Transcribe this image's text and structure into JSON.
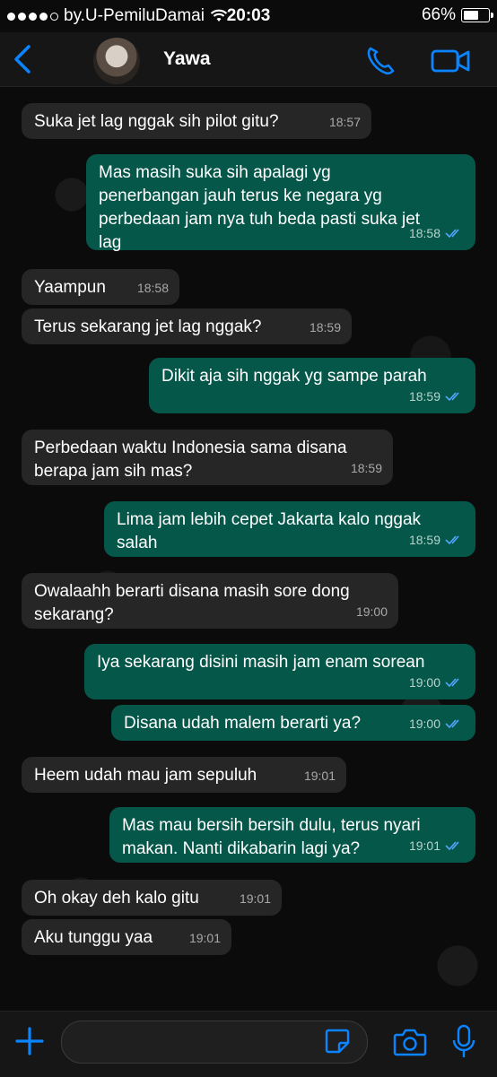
{
  "status": {
    "carrier": "by.U-PemiluDamai",
    "time": "20:03",
    "battery": "66%",
    "battery_level": 0.66,
    "signal_dots": 4
  },
  "header": {
    "contact_name": "Yawa",
    "back_icon": "chevron-left-icon",
    "call_icon": "phone-icon",
    "video_icon": "video-camera-icon"
  },
  "colors": {
    "accent": "#0a84ff",
    "incoming_bubble": "#262626",
    "outgoing_bubble": "#05574a",
    "tick": "#53a6ff"
  },
  "messages": [
    {
      "dir": "in",
      "text": "Suka jet lag nggak sih pilot gitu?",
      "time": "18:57"
    },
    {
      "dir": "out",
      "text": "Mas masih suka sih apalagi yg\npenerbangan jauh terus ke negara yg\nperbedaan jam nya tuh beda pasti suka jet\nlag",
      "time": "18:58"
    },
    {
      "dir": "in",
      "text": "Yaampun",
      "time": "18:58"
    },
    {
      "dir": "in",
      "text": "Terus sekarang jet lag nggak?",
      "time": "18:59"
    },
    {
      "dir": "out",
      "text": "Dikit aja sih nggak yg sampe parah",
      "time": "18:59"
    },
    {
      "dir": "in",
      "text": "Perbedaan waktu Indonesia sama disana\nberapa jam sih mas?",
      "time": "18:59"
    },
    {
      "dir": "out",
      "text": "Lima jam lebih cepet Jakarta kalo nggak\nsalah",
      "time": "18:59"
    },
    {
      "dir": "in",
      "text": "Owalaahh berarti disana masih sore dong\nsekarang?",
      "time": "19:00"
    },
    {
      "dir": "out",
      "text": "Iya sekarang disini masih jam enam sorean",
      "time": "19:00"
    },
    {
      "dir": "out",
      "text": "Disana udah malem berarti ya?",
      "time": "19:00"
    },
    {
      "dir": "in",
      "text": "Heem udah mau jam sepuluh",
      "time": "19:01"
    },
    {
      "dir": "out",
      "text": "Mas mau bersih bersih dulu, terus nyari\nmakan. Nanti dikabarin lagi ya?",
      "time": "19:01"
    },
    {
      "dir": "in",
      "text": "Oh okay deh kalo gitu",
      "time": "19:01"
    },
    {
      "dir": "in",
      "text": "Aku tunggu yaa",
      "time": "19:01"
    }
  ],
  "composer": {
    "plus_icon": "plus-icon",
    "sticker_icon": "sticker-icon",
    "camera_icon": "camera-icon",
    "mic_icon": "microphone-icon"
  }
}
